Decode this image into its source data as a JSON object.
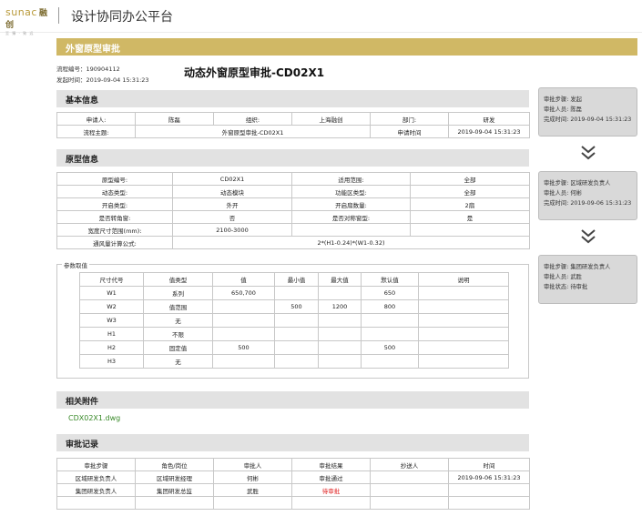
{
  "logo": {
    "brand": "sunac",
    "brand_cn": "融创",
    "sub": "至 臻 · 致 远"
  },
  "app": {
    "title": "设计协同办公平台"
  },
  "banner": {
    "title": "外窗原型审批"
  },
  "process": {
    "number_label": "流程编号：",
    "number": "190904112",
    "time_label": "发起时间：",
    "time": "2019-09-04 15:31:23",
    "title": "动态外窗原型审批-CD02X1"
  },
  "sections": {
    "basic": "基本信息",
    "prototype": "原型信息",
    "params": "参数取值",
    "attachments": "相关附件",
    "records": "审批记录"
  },
  "basic_info": {
    "row1": [
      "申请人:",
      "陈磊",
      "组织:",
      "上海融创",
      "部门:",
      "研发"
    ],
    "row2": [
      "流程主题:",
      "外窗原型审批-CD02X1",
      "申请时间",
      "2019-09-04 15:31:23"
    ]
  },
  "prototype_info": {
    "rows": [
      [
        "原型编号:",
        "CD02X1",
        "适用范围:",
        "全部"
      ],
      [
        "动态类型:",
        "动态模块",
        "功能区类型:",
        "全部"
      ],
      [
        "开启类型:",
        "外开",
        "开启扇数量:",
        "2扇"
      ],
      [
        "是否转角窗:",
        "否",
        "是否对称窗型:",
        "是"
      ],
      [
        "宽度尺寸范围(mm):",
        "2100-3000",
        "",
        ""
      ]
    ],
    "formula_label": "通风量计算公式:",
    "formula": "2*(H1-0.24)*(W1-0.32)"
  },
  "params_table": {
    "headers": [
      "尺寸代号",
      "值类型",
      "值",
      "最小值",
      "最大值",
      "默认值",
      "说明"
    ],
    "rows": [
      [
        "W1",
        "系列",
        "650,700",
        "",
        "",
        "650",
        ""
      ],
      [
        "W2",
        "值范围",
        "",
        "500",
        "1200",
        "800",
        ""
      ],
      [
        "W3",
        "无",
        "",
        "",
        "",
        "",
        ""
      ],
      [
        "H1",
        "不限",
        "",
        "",
        "",
        "",
        ""
      ],
      [
        "H2",
        "固定值",
        "500",
        "",
        "",
        "500",
        ""
      ],
      [
        "H3",
        "无",
        "",
        "",
        "",
        "",
        ""
      ]
    ]
  },
  "attachments": [
    {
      "name": "CDX02X1.dwg"
    }
  ],
  "records_table": {
    "headers": [
      "审批步骤",
      "角色/岗位",
      "审批人",
      "审批结果",
      "抄送人",
      "时间"
    ],
    "rows": [
      [
        "区域研发负责人",
        "区域研发经理",
        "何彬",
        "审批通过",
        "",
        "2019-09-06 15:31:23"
      ],
      [
        "集团研发负责人",
        "集团研发总监",
        "武胜",
        "待审批",
        "",
        ""
      ],
      [
        "",
        "",
        "",
        "",
        "",
        ""
      ]
    ]
  },
  "flow": [
    {
      "step_label": "审批步骤:",
      "step": "发起",
      "person_label": "审批人员:",
      "person": "陈磊",
      "time_label": "完成时间:",
      "time": "2019-09-04 15:31:23"
    },
    {
      "step_label": "审批步骤:",
      "step": "区域研发负责人",
      "person_label": "审批人员:",
      "person": "何彬",
      "time_label": "完成时间:",
      "time": "2019-09-06 15:31:23"
    },
    {
      "step_label": "审批步骤:",
      "step": "集团研发负责人",
      "person_label": "审批人员:",
      "person": "武胜",
      "time_label": "审批状态:",
      "time": "待审批"
    }
  ],
  "colors": {
    "accent": "#d0b865",
    "section_bg": "#e2e2e2",
    "pending": "#e02020",
    "link": "#3a8a2a"
  }
}
